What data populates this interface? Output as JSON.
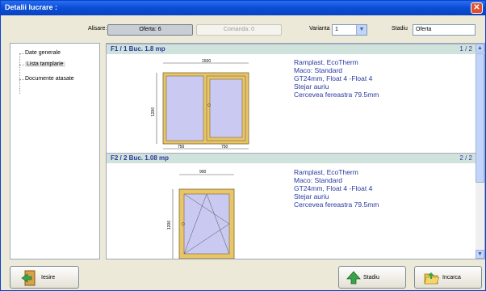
{
  "window": {
    "title": "Detalii lucrare :"
  },
  "topbar": {
    "alisare_label": "Alisare:",
    "oferta_button": "Oferta: 6",
    "comanda_button": "Comanda: 0",
    "varianta_label": "Varianta",
    "varianta_value": "1",
    "stadiu_label": "Stadiu",
    "stadiu_value": "Oferta"
  },
  "sidebar": {
    "items": [
      {
        "label": "Date generale"
      },
      {
        "label": "Lista tamplarie"
      },
      {
        "label": "Documente atasate"
      }
    ]
  },
  "items": [
    {
      "header": "F1 / 1 Buc.  1.8 mp",
      "page": "1 / 2",
      "specs": [
        "Ramplast, EcoTherm",
        "Maco:  Standard",
        "GT24mm, Float 4 -Float 4",
        "Stejar auriu",
        "Cercevea fereastra 79.5mm"
      ],
      "dims": {
        "width": "1500",
        "height": "1200",
        "left": "750",
        "right": "750"
      }
    },
    {
      "header": "F2 / 2 Buc.  1.08 mp",
      "page": "2 / 2",
      "specs": [
        "Ramplast, EcoTherm",
        "Maco:  Standard",
        "GT24mm, Float 4 -Float 4",
        "Stejar auriu",
        "Cercevea fereastra 79.5mm"
      ],
      "dims": {
        "width": "900",
        "height": "1200"
      }
    }
  ],
  "buttons": {
    "iesire": "Iesire",
    "stadiu": "Stadiu",
    "incarca": "Incarca"
  },
  "colors": {
    "frame": "#e8c46a",
    "glass": "#c9c9f2",
    "accent": "#2a3aa0",
    "title": "#0b4fd8"
  }
}
